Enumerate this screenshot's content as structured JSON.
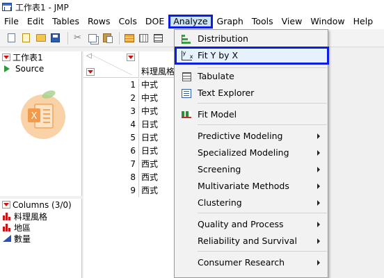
{
  "window": {
    "title": "工作表1 - JMP"
  },
  "menubar": {
    "items": [
      "File",
      "Edit",
      "Tables",
      "Rows",
      "Cols",
      "DOE",
      "Analyze",
      "Graph",
      "Tools",
      "View",
      "Window",
      "Help"
    ],
    "active": "Analyze"
  },
  "toolbar": {
    "icons": [
      "new-table-icon",
      "new-script-icon",
      "open-icon",
      "save-icon",
      "cut-icon",
      "copy-icon",
      "paste-icon",
      "data-table-icon",
      "grid-icon",
      "grid-lines-icon"
    ]
  },
  "tables_panel": {
    "title": "工作表1",
    "items": [
      {
        "label": "Source",
        "icon": "play-icon"
      }
    ]
  },
  "columns_panel": {
    "title": "Columns (3/0)",
    "items": [
      {
        "label": "料理風格",
        "icon": "nominal-bar-icon"
      },
      {
        "label": "地區",
        "icon": "nominal-bar-icon"
      },
      {
        "label": "數量",
        "icon": "continuous-triangle-icon"
      }
    ]
  },
  "grid": {
    "column_header": "料理風格",
    "rows": [
      {
        "n": "1",
        "value": "中式"
      },
      {
        "n": "2",
        "value": "中式"
      },
      {
        "n": "3",
        "value": "中式"
      },
      {
        "n": "4",
        "value": "日式"
      },
      {
        "n": "5",
        "value": "日式"
      },
      {
        "n": "6",
        "value": "日式"
      },
      {
        "n": "7",
        "value": "西式"
      },
      {
        "n": "8",
        "value": "西式"
      },
      {
        "n": "9",
        "value": "西式"
      }
    ]
  },
  "analyze_menu": {
    "items": [
      {
        "label": "Distribution",
        "icon": "distribution-icon",
        "submenu": false
      },
      {
        "label": "Fit Y by X",
        "icon": "fit-y-by-x-icon",
        "submenu": false,
        "highlighted": true
      },
      {
        "label": "Tabulate",
        "icon": "tabulate-icon",
        "submenu": false
      },
      {
        "label": "Text Explorer",
        "icon": "text-explorer-icon",
        "submenu": false
      },
      {
        "label": "Fit Model",
        "icon": "fit-model-icon",
        "submenu": false
      },
      {
        "label": "Predictive Modeling",
        "submenu": true
      },
      {
        "label": "Specialized Modeling",
        "submenu": true
      },
      {
        "label": "Screening",
        "submenu": true
      },
      {
        "label": "Multivariate Methods",
        "submenu": true
      },
      {
        "label": "Clustering",
        "submenu": true
      },
      {
        "label": "Quality and Process",
        "submenu": true
      },
      {
        "label": "Reliability and Survival",
        "submenu": true
      },
      {
        "label": "Consumer Research",
        "submenu": true
      }
    ]
  },
  "colors": {
    "highlight_border": "#0a1de0",
    "highlight_fill": "#e5f1fb",
    "red_triangle": "#d01010"
  }
}
